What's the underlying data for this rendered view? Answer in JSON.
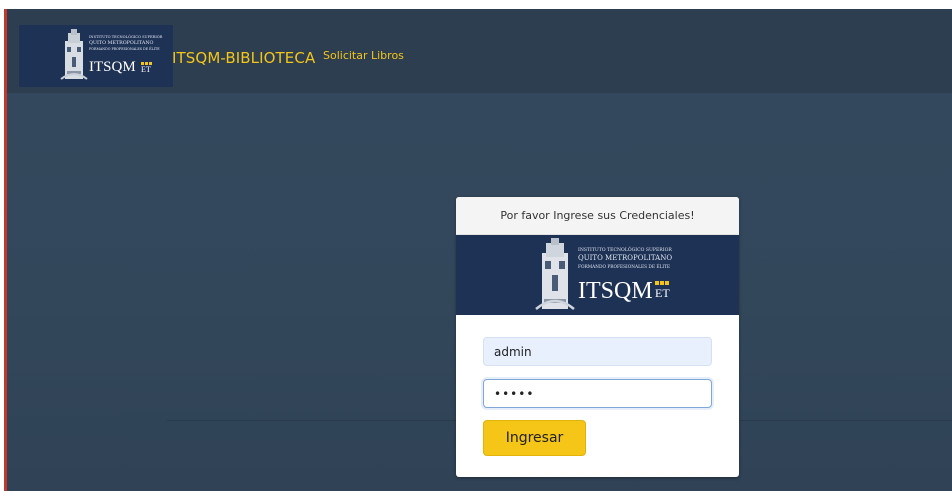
{
  "navbar": {
    "logo": {
      "line1": "INSTITUTO TECNOLÓGICO SUPERIOR",
      "line2": "QUITO METROPOLITANO",
      "line3": "FORMANDO PROFESIONALES DE ÉLITE",
      "wordmark": "ITSQM",
      "suffix": "ET"
    },
    "brand": "ITSQM-BIBLIOTECA",
    "link_solicitar": "Solicitar Libros"
  },
  "login": {
    "header": "Por favor Ingrese sus Credenciales!",
    "logo": {
      "line1": "INSTITUTO TECNOLÓGICO SUPERIOR",
      "line2": "QUITO METROPOLITANO",
      "line3": "FORMANDO PROFESIONALES DE ÉLITE",
      "wordmark": "ITSQM",
      "suffix": "ET"
    },
    "username_value": "admin",
    "password_value": "•••••",
    "submit_label": "Ingresar"
  },
  "colors": {
    "page_bg": "#34495e",
    "navbar_bg": "#2c3e50",
    "brand_accent": "#f5c518",
    "logo_bg": "#1e3256",
    "window_edge": "#c0392b"
  }
}
